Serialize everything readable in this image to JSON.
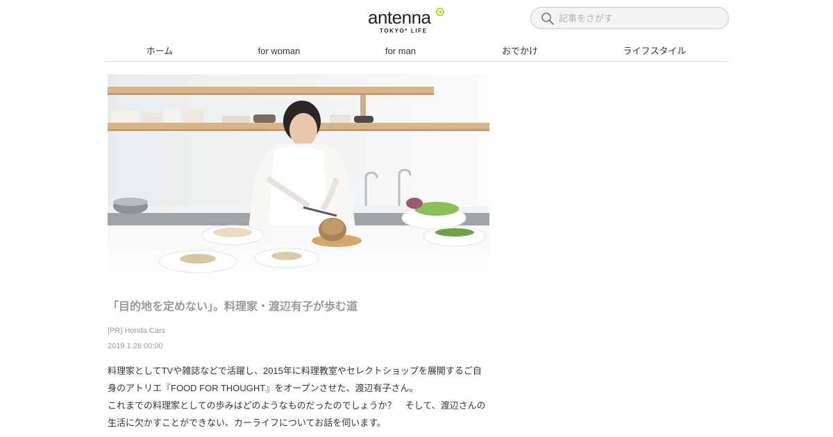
{
  "header": {
    "logo_text": "antenna",
    "logo_subtext": "TOKYO* LIFE",
    "search_placeholder": "記事をさがす"
  },
  "nav": {
    "items": [
      {
        "label": "ホーム"
      },
      {
        "label": "for woman"
      },
      {
        "label": "for man"
      },
      {
        "label": "おでかけ"
      },
      {
        "label": "ライフスタイル"
      }
    ]
  },
  "article": {
    "title": "「目的地を定めない」。料理家・渡辺有子が歩む道",
    "sponsor": "[PR] Honda Cars",
    "date": "2019.1.26 00:00",
    "lead_lines": [
      "料理家としてTVや雑誌などで活躍し、2015年に料理教室やセレクトショップを展開するご自",
      "身のアトリエ『FOOD FOR THOUGHT』をオープンさせた、渡辺有子さん。",
      "これまでの料理家としての歩みはどのようなものだったのでしょうか？　そして、渡辺さんの",
      "生活に欠かすことができない、カーライフについてお話を伺います。"
    ]
  },
  "colors": {
    "accent": "#b5d22a",
    "title_gray": "#999999",
    "text": "#333333",
    "divider": "#dddddd"
  },
  "icons": {
    "search": "search-icon",
    "logo_mark": "logo-dot-icon"
  }
}
